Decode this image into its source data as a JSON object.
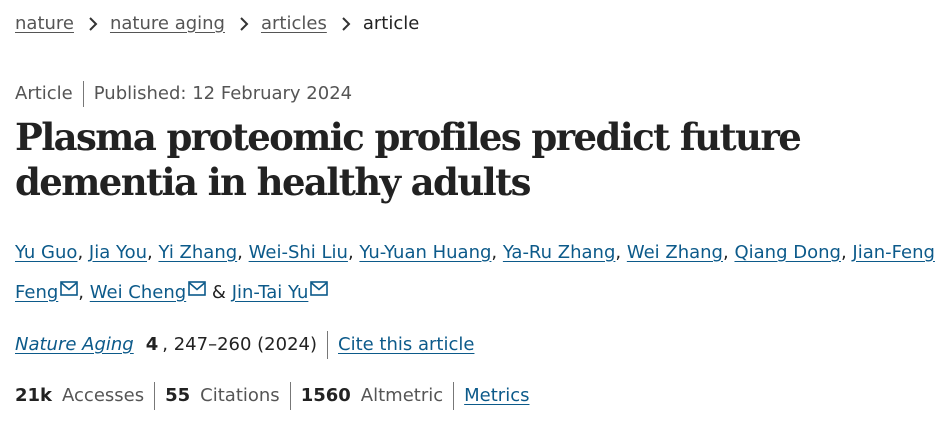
{
  "breadcrumb": {
    "items": [
      "nature",
      "nature aging",
      "articles"
    ],
    "current": "article"
  },
  "meta": {
    "type": "Article",
    "published": "Published: 12 February 2024"
  },
  "title": "Plasma proteomic profiles predict future dementia in healthy adults",
  "authors": [
    "Yu Guo",
    "Jia You",
    "Yi Zhang",
    "Wei-Shi Liu",
    "Yu-Yuan Huang",
    "Ya-Ru Zhang",
    "Wei Zhang",
    "Qiang Dong",
    "Jian-Feng Feng",
    "Wei Cheng",
    "Jin-Tai Yu"
  ],
  "separators": {
    "comma": ",",
    "and": "&"
  },
  "icons": {
    "mail": "mail-icon",
    "chevron": "chevron-right-icon"
  },
  "citation": {
    "journal": "Nature Aging",
    "volume": "4",
    "pages": ", 247–260 (2024)",
    "cite_link": "Cite this article"
  },
  "metrics": {
    "accesses_value": "21k",
    "accesses_label": "Accesses",
    "citations_value": "55",
    "citations_label": "Citations",
    "altmetric_value": "1560",
    "altmetric_label": "Altmetric",
    "metrics_link": "Metrics"
  },
  "colors": {
    "link": "#0c5a8a",
    "text": "#222222",
    "muted": "#555555"
  }
}
